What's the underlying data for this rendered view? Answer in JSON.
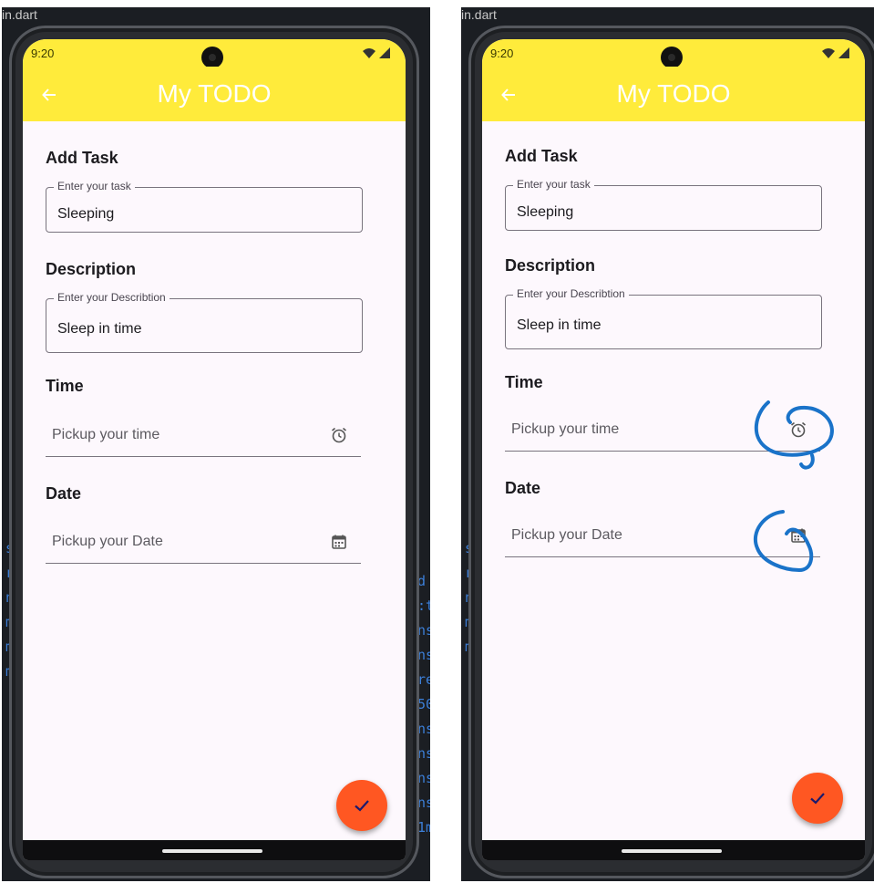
{
  "background": {
    "editor_tab": "in.dart",
    "code_fragments": [
      "s",
      "r",
      "n",
      "ms",
      "ms",
      "ren",
      "50m",
      "ms",
      "ms",
      "ms",
      "ms",
      "ms",
      "ms",
      "1ms"
    ]
  },
  "phones": [
    {
      "status": {
        "time": "9:20"
      },
      "appbar": {
        "title": "My TODO"
      },
      "form": {
        "task": {
          "section_label": "Add Task",
          "field_label": "Enter your task",
          "value": "Sleeping"
        },
        "description": {
          "section_label": "Description",
          "field_label": "Enter your Describtion",
          "value": "Sleep in time"
        },
        "time": {
          "section_label": "Time",
          "placeholder": "Pickup your time"
        },
        "date": {
          "section_label": "Date",
          "placeholder": "Pickup your Date"
        }
      },
      "icons": {
        "back": "arrow-back-icon",
        "time": "alarm-icon",
        "date": "calendar-icon",
        "fab": "check-icon"
      },
      "colors": {
        "appbar": "#ffeb3b",
        "fab": "#ff5722",
        "screen": "#fdf8fd"
      },
      "annotations_visible": false
    },
    {
      "status": {
        "time": "9:20"
      },
      "appbar": {
        "title": "My TODO"
      },
      "form": {
        "task": {
          "section_label": "Add Task",
          "field_label": "Enter your task",
          "value": "Sleeping"
        },
        "description": {
          "section_label": "Description",
          "field_label": "Enter your Describtion",
          "value": "Sleep in time"
        },
        "time": {
          "section_label": "Time",
          "placeholder": "Pickup your time"
        },
        "date": {
          "section_label": "Date",
          "placeholder": "Pickup your Date"
        }
      },
      "icons": {
        "back": "arrow-back-icon",
        "time": "alarm-icon",
        "date": "calendar-icon",
        "fab": "check-icon"
      },
      "colors": {
        "appbar": "#ffeb3b",
        "fab": "#ff5722",
        "screen": "#fdf8fd",
        "annotation": "#1a73c9"
      },
      "annotations_visible": true
    }
  ]
}
